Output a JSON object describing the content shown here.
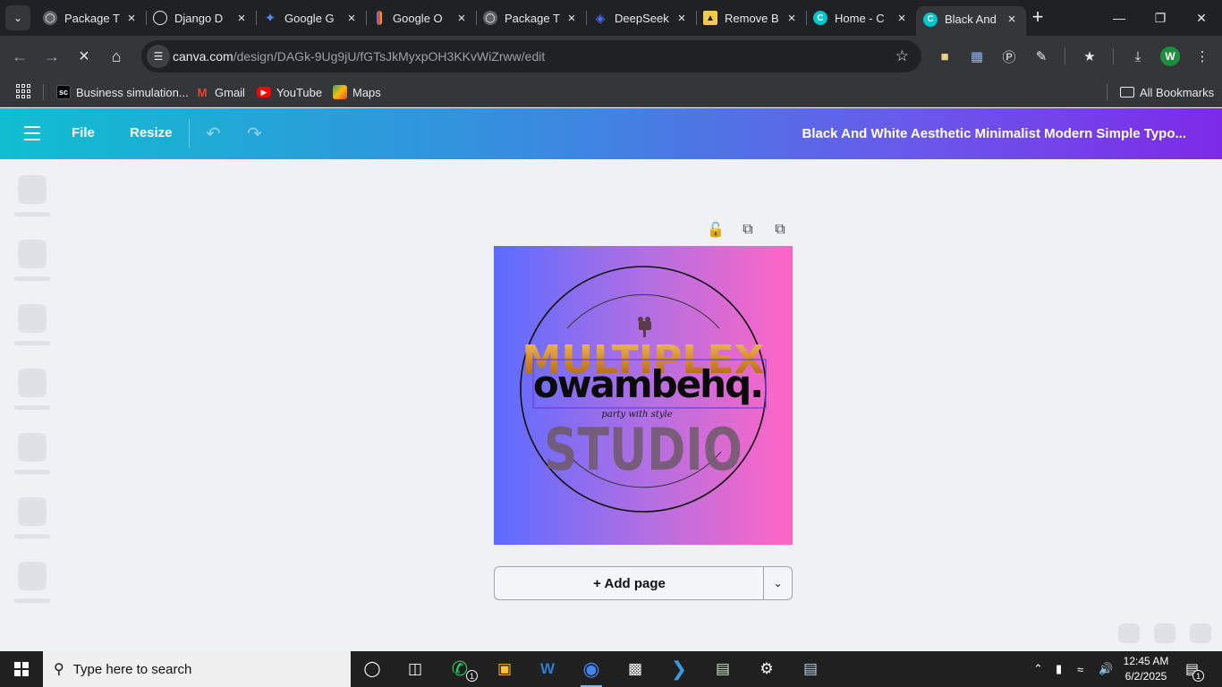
{
  "browser": {
    "tabs": [
      {
        "title": "Package T",
        "icon": "globe-icon",
        "color": "#9aa0a6",
        "active": false
      },
      {
        "title": "Django D",
        "icon": "openai-icon",
        "color": "#e8eaed",
        "active": false
      },
      {
        "title": "Google G",
        "icon": "gemini-icon",
        "color": "#4e8cf6",
        "active": false
      },
      {
        "title": "Google O",
        "icon": "gcloud-icon",
        "color": "#f4b400",
        "active": false
      },
      {
        "title": "Package T",
        "icon": "globe-icon",
        "color": "#9aa0a6",
        "active": false
      },
      {
        "title": "DeepSeek",
        "icon": "deepseek-icon",
        "color": "#4d6bfe",
        "active": false
      },
      {
        "title": "Remove B",
        "icon": "removebg-icon",
        "color": "#f2c94c",
        "active": false
      },
      {
        "title": "Home - C",
        "icon": "canva-icon",
        "color": "#00c4cc",
        "active": false
      },
      {
        "title": "Black And",
        "icon": "canva-icon",
        "color": "#00c4cc",
        "active": true
      }
    ],
    "url_host": "canva.com",
    "url_path": "/design/DAGk-9Ug9jU/fGTsJkMyxpOH3KKvWiZrww/edit",
    "profile_initial": "W",
    "bookmarks": [
      {
        "label": "Business simulation...",
        "icon": "sc-icon"
      },
      {
        "label": "Gmail",
        "icon": "gmail-icon"
      },
      {
        "label": "YouTube",
        "icon": "youtube-icon"
      },
      {
        "label": "Maps",
        "icon": "maps-icon"
      }
    ],
    "all_bookmarks": "All Bookmarks"
  },
  "canva": {
    "menu_file": "File",
    "menu_resize": "Resize",
    "doc_title": "Black And White Aesthetic Minimalist Modern Simple Typo...",
    "add_page": "+ Add page",
    "design": {
      "background_from": "#5b6cff",
      "background_to": "#ff66c4",
      "logo_top": "MULTIPLEX",
      "logo_bottom": "STUDIO",
      "brand": "owambehq.",
      "tagline": "party with style"
    }
  },
  "taskbar": {
    "search_placeholder": "Type here to search",
    "time": "12:45 AM",
    "date": "6/2/2025",
    "whatsapp_badge": "1",
    "notifications_badge": "1"
  }
}
